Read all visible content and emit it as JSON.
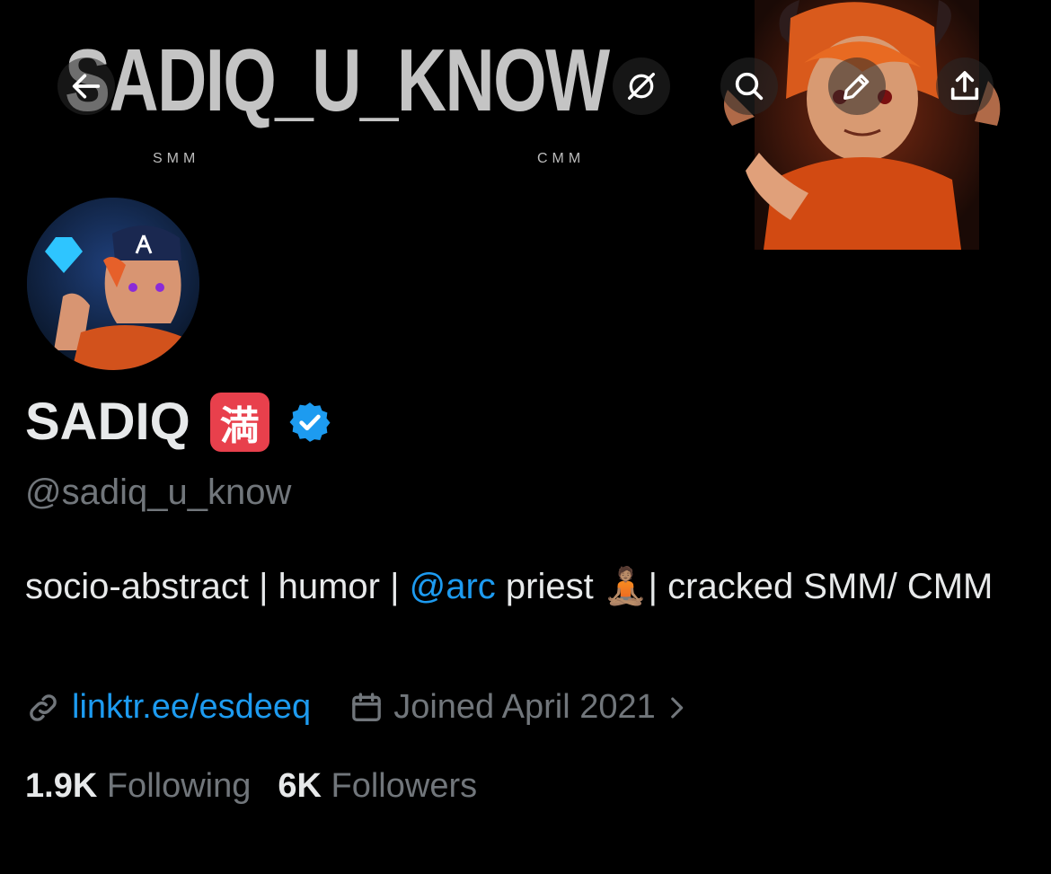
{
  "banner": {
    "title": "SADIQ_U_KNOW",
    "sub_left": "SMM",
    "sub_right": "CMM"
  },
  "nav": {
    "back_icon": "arrow-left-icon",
    "grok_icon": "grok-icon",
    "search_icon": "search-icon",
    "edit_icon": "pencil-icon",
    "share_icon": "share-icon"
  },
  "profile": {
    "name": "SADIQ",
    "name_emoji": "満",
    "handle": "@sadiq_u_know",
    "bio_part1": "socio-abstract | humor | ",
    "bio_mention": "@arc",
    "bio_part2": " priest 🧘🏽| cracked SMM/ CMM",
    "link": "linktr.ee/esdeeq",
    "joined": "Joined April 2021"
  },
  "stats": {
    "following_count": "1.9K",
    "following_label": "Following",
    "followers_count": "6K",
    "followers_label": "Followers"
  },
  "colors": {
    "accent": "#1d9bf0",
    "muted": "#71767b",
    "text": "#e7e9ea",
    "background": "#000000"
  }
}
